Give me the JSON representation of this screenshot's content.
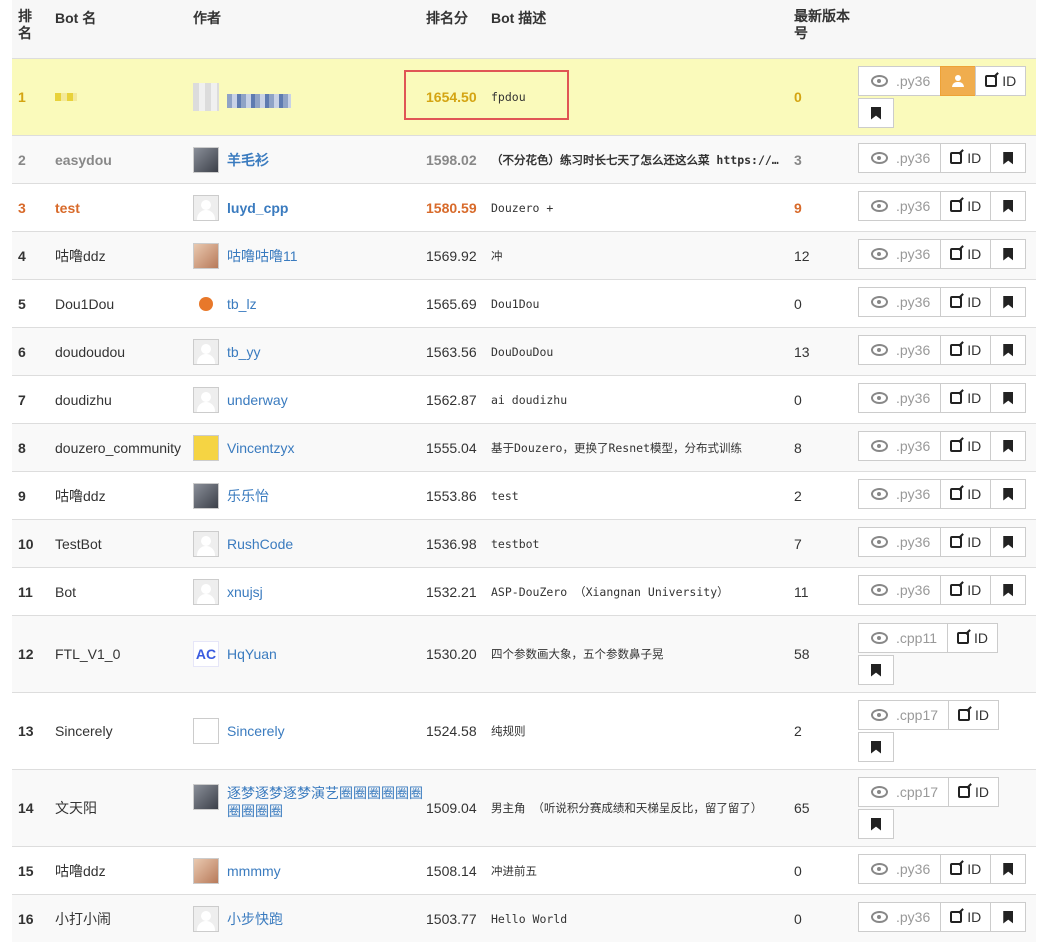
{
  "headers": {
    "rank": "排名",
    "name": "Bot 名",
    "author": "作者",
    "score": "排名分",
    "desc": "Bot 描述",
    "version": "最新版本号"
  },
  "actions": {
    "id_label": "ID",
    "view_icon": "eye-icon",
    "id_icon": "external-link-icon",
    "bookmark_icon": "bookmark-icon",
    "user_icon": "user-icon"
  },
  "colors": {
    "highlight": "#fafabb",
    "gold": "#d4a412",
    "orange": "#d86a2a",
    "link": "#3a7bbf",
    "user_button": "#f0ad4e"
  },
  "rows": [
    {
      "rank": "1",
      "name": "",
      "author": "",
      "score": "1654.50",
      "desc": "fpdou",
      "version": "0",
      "lang": ".py36"
    },
    {
      "rank": "2",
      "name": "easydou",
      "author": "羊毛衫",
      "score": "1598.02",
      "desc": "（不分花色）练习时长七天了怎么还这么菜 https://…",
      "version": "3",
      "lang": ".py36"
    },
    {
      "rank": "3",
      "name": "test",
      "author": "luyd_cpp",
      "score": "1580.59",
      "desc": "Douzero +",
      "version": "9",
      "lang": ".py36"
    },
    {
      "rank": "4",
      "name": "咕噜ddz",
      "author": "咕噜咕噜11",
      "score": "1569.92",
      "desc": "冲",
      "version": "12",
      "lang": ".py36"
    },
    {
      "rank": "5",
      "name": "Dou1Dou",
      "author": "tb_lz",
      "score": "1565.69",
      "desc": "Dou1Dou",
      "version": "0",
      "lang": ".py36"
    },
    {
      "rank": "6",
      "name": "doudoudou",
      "author": "tb_yy",
      "score": "1563.56",
      "desc": "DouDouDou",
      "version": "13",
      "lang": ".py36"
    },
    {
      "rank": "7",
      "name": "doudizhu",
      "author": "underway",
      "score": "1562.87",
      "desc": "ai doudizhu",
      "version": "0",
      "lang": ".py36"
    },
    {
      "rank": "8",
      "name": "douzero_community",
      "author": "Vincentzyx",
      "score": "1555.04",
      "desc": "基于Douzero，更换了Resnet模型，分布式训练",
      "version": "8",
      "lang": ".py36"
    },
    {
      "rank": "9",
      "name": "咕噜ddz",
      "author": "乐乐怡",
      "score": "1553.86",
      "desc": "test",
      "version": "2",
      "lang": ".py36"
    },
    {
      "rank": "10",
      "name": "TestBot",
      "author": "RushCode",
      "score": "1536.98",
      "desc": "testbot",
      "version": "7",
      "lang": ".py36"
    },
    {
      "rank": "11",
      "name": "Bot",
      "author": "xnujsj",
      "score": "1532.21",
      "desc": "ASP-DouZero （Xiangnan University）",
      "version": "11",
      "lang": ".py36"
    },
    {
      "rank": "12",
      "name": "FTL_V1_0",
      "author": "HqYuan",
      "score": "1530.20",
      "desc": "四个参数画大象，五个参数鼻子晃",
      "version": "58",
      "lang": ".cpp11",
      "avatar_text": "AC"
    },
    {
      "rank": "13",
      "name": "Sincerely",
      "author": "Sincerely",
      "score": "1524.58",
      "desc": "纯规则",
      "version": "2",
      "lang": ".cpp17"
    },
    {
      "rank": "14",
      "name": "文天阳",
      "author": "逐梦逐梦逐梦演艺圈圈圈圈圈圈圈圈圈圈",
      "score": "1509.04",
      "desc": "男主角 （听说积分赛成绩和天梯呈反比，留了留了）",
      "version": "65",
      "lang": ".cpp17"
    },
    {
      "rank": "15",
      "name": "咕噜ddz",
      "author": "mmmmy",
      "score": "1508.14",
      "desc": "冲进前五",
      "version": "0",
      "lang": ".py36"
    },
    {
      "rank": "16",
      "name": "小打小闹",
      "author": "小步快跑",
      "score": "1503.77",
      "desc": "Hello World",
      "version": "0",
      "lang": ".py36"
    }
  ]
}
